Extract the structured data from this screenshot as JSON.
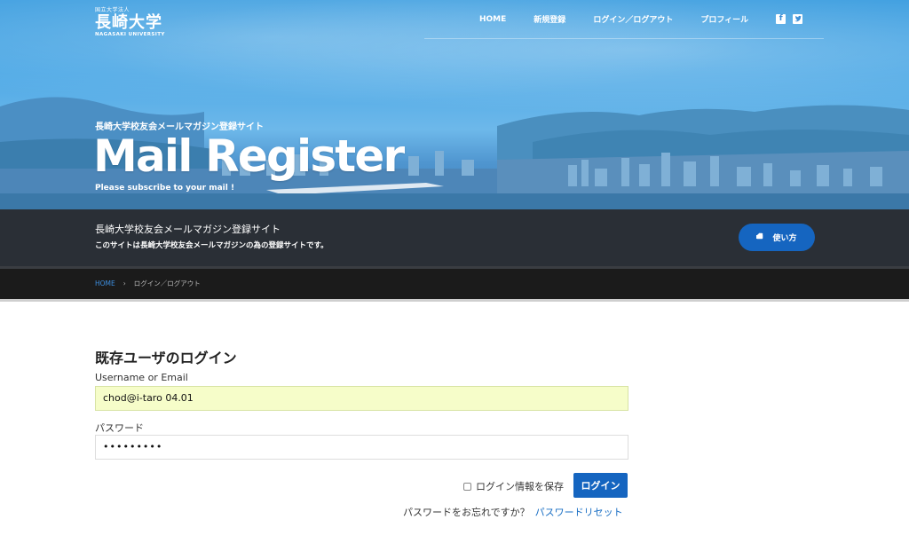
{
  "logo": {
    "small": "国立大学法人",
    "name": "長崎大学",
    "english": "NAGASAKI UNIVERSITY"
  },
  "nav": {
    "items": [
      "HOME",
      "新規登録",
      "ログイン／ログアウト",
      "プロフィール"
    ]
  },
  "hero": {
    "subtitle": "長崎大学校友会メールマガジン登録サイト",
    "title": "Mail Register",
    "tagline": "Please subscribe to your mail !"
  },
  "info": {
    "title": "長崎大学校友会メールマガジン登録サイト",
    "description": "このサイトは長崎大学校友会メールマガジンの為の登録サイトです。",
    "howto_label": "使い方"
  },
  "breadcrumb": {
    "home": "HOME",
    "separator": "›",
    "current": "ログイン／ログアウト"
  },
  "login": {
    "heading": "既存ユーザのログイン",
    "username_label": "Username or Email",
    "username_value": "chod@i-taro 04.01",
    "password_label": "パスワード",
    "password_value": "•••••••••",
    "remember_label": "ログイン情報を保存",
    "submit_label": "ログイン",
    "forgot_text": "パスワードをお忘れですか？",
    "reset_link": "パスワードリセット"
  },
  "colors": {
    "accent": "#1565c0",
    "info_bar": "#2a2f36",
    "breadcrumb_bar": "#1b1b1b",
    "autofill": "#f6fdc9"
  }
}
